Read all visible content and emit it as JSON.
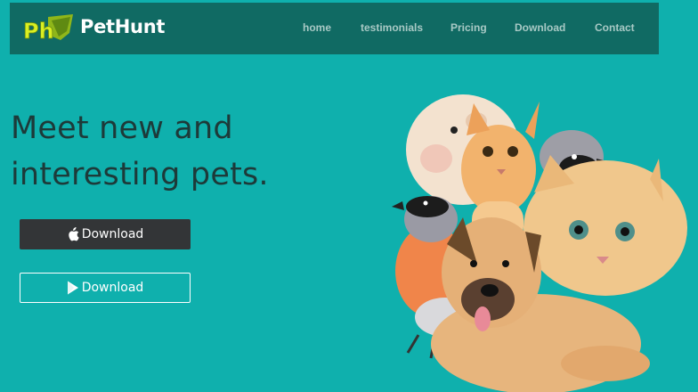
{
  "brand": {
    "logo_mark_text": "Ph",
    "name": "PetHunt"
  },
  "nav": {
    "links": [
      {
        "label": "home"
      },
      {
        "label": "testimonials"
      },
      {
        "label": "Pricing"
      },
      {
        "label": "Download"
      },
      {
        "label": "Contact"
      }
    ]
  },
  "hero": {
    "headline_line1": "Meet new and",
    "headline_line2": "interesting pets.",
    "download_ios_label": "Download",
    "download_android_label": "Download",
    "ios_icon": "apple-icon",
    "android_icon": "play-store-icon"
  },
  "colors": {
    "hero_bg": "#0fb0ad",
    "nav_bg": "#106a63",
    "nav_text": "#a8c9c5",
    "headline": "#1d3a39",
    "dark_button": "#333537",
    "logo_green": "#c4e21a"
  }
}
